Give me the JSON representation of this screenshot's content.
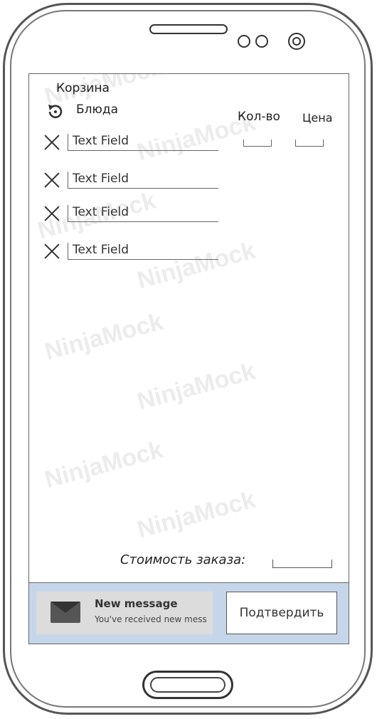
{
  "screen": {
    "title": "Корзина",
    "dishes_label": "Блюда",
    "qty_header": "Кол-во",
    "price_header": "Цена",
    "items": [
      {
        "placeholder": "Text Field"
      },
      {
        "placeholder": "Text Field"
      },
      {
        "placeholder": "Text Field"
      },
      {
        "placeholder": "Text Field"
      }
    ],
    "total_label": "Стоимость заказа:",
    "watermark": "NinjaMock"
  },
  "notification": {
    "title": "New message",
    "text": "You've received new mess"
  },
  "actions": {
    "confirm_label": "Подтвердить"
  },
  "icons": {
    "refresh": "refresh-icon",
    "remove": "close-icon",
    "mail": "mail-icon"
  }
}
